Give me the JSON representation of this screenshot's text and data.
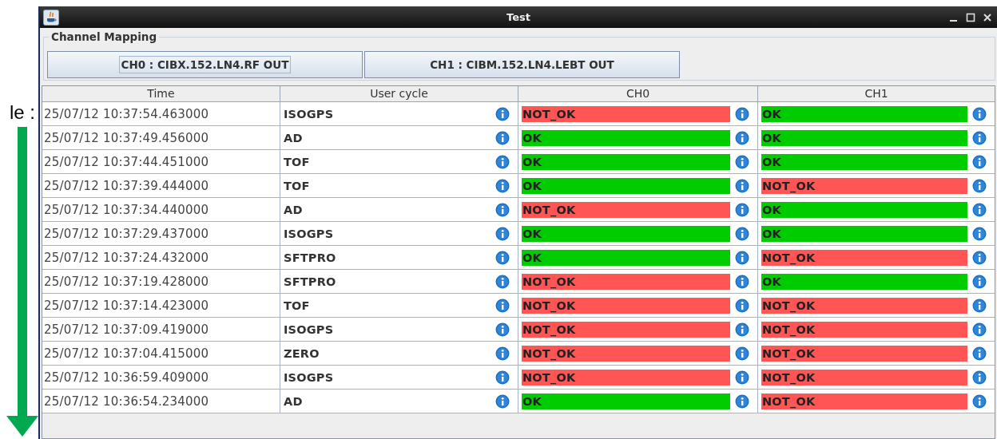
{
  "annotation": {
    "label": "le :"
  },
  "window": {
    "title": "Test"
  },
  "channel_mapping": {
    "title": "Channel Mapping",
    "buttons": [
      {
        "label": "CH0 : CIBX.152.LN4.RF OUT",
        "focused": true
      },
      {
        "label": "CH1 : CIBM.152.LN4.LEBT OUT",
        "focused": false
      }
    ]
  },
  "table": {
    "columns": [
      "Time",
      "User cycle",
      "CH0",
      "CH1"
    ],
    "rows": [
      {
        "time": "25/07/12 10:37:54.463000",
        "cycle": "ISOGPS",
        "ch0": {
          "status": "NOT_OK",
          "ok": false
        },
        "ch1": {
          "status": "OK",
          "ok": true
        }
      },
      {
        "time": "25/07/12 10:37:49.456000",
        "cycle": "AD",
        "ch0": {
          "status": "OK",
          "ok": true
        },
        "ch1": {
          "status": "OK",
          "ok": true
        }
      },
      {
        "time": "25/07/12 10:37:44.451000",
        "cycle": "TOF",
        "ch0": {
          "status": "OK",
          "ok": true
        },
        "ch1": {
          "status": "OK",
          "ok": true
        }
      },
      {
        "time": "25/07/12 10:37:39.444000",
        "cycle": "TOF",
        "ch0": {
          "status": "OK",
          "ok": true
        },
        "ch1": {
          "status": "NOT_OK",
          "ok": false
        }
      },
      {
        "time": "25/07/12 10:37:34.440000",
        "cycle": "AD",
        "ch0": {
          "status": "NOT_OK",
          "ok": false
        },
        "ch1": {
          "status": "OK",
          "ok": true
        }
      },
      {
        "time": "25/07/12 10:37:29.437000",
        "cycle": "ISOGPS",
        "ch0": {
          "status": "OK",
          "ok": true
        },
        "ch1": {
          "status": "OK",
          "ok": true
        }
      },
      {
        "time": "25/07/12 10:37:24.432000",
        "cycle": "SFTPRO",
        "ch0": {
          "status": "OK",
          "ok": true
        },
        "ch1": {
          "status": "NOT_OK",
          "ok": false
        }
      },
      {
        "time": "25/07/12 10:37:19.428000",
        "cycle": "SFTPRO",
        "ch0": {
          "status": "NOT_OK",
          "ok": false
        },
        "ch1": {
          "status": "OK",
          "ok": true
        }
      },
      {
        "time": "25/07/12 10:37:14.423000",
        "cycle": "TOF",
        "ch0": {
          "status": "NOT_OK",
          "ok": false
        },
        "ch1": {
          "status": "NOT_OK",
          "ok": false
        }
      },
      {
        "time": "25/07/12 10:37:09.419000",
        "cycle": "ISOGPS",
        "ch0": {
          "status": "NOT_OK",
          "ok": false
        },
        "ch1": {
          "status": "NOT_OK",
          "ok": false
        }
      },
      {
        "time": "25/07/12 10:37:04.415000",
        "cycle": "ZERO",
        "ch0": {
          "status": "NOT_OK",
          "ok": false
        },
        "ch1": {
          "status": "NOT_OK",
          "ok": false
        }
      },
      {
        "time": "25/07/12 10:36:59.409000",
        "cycle": "ISOGPS",
        "ch0": {
          "status": "NOT_OK",
          "ok": false
        },
        "ch1": {
          "status": "NOT_OK",
          "ok": false
        }
      },
      {
        "time": "25/07/12 10:36:54.234000",
        "cycle": "AD",
        "ch0": {
          "status": "OK",
          "ok": true
        },
        "ch1": {
          "status": "NOT_OK",
          "ok": false
        }
      }
    ]
  }
}
